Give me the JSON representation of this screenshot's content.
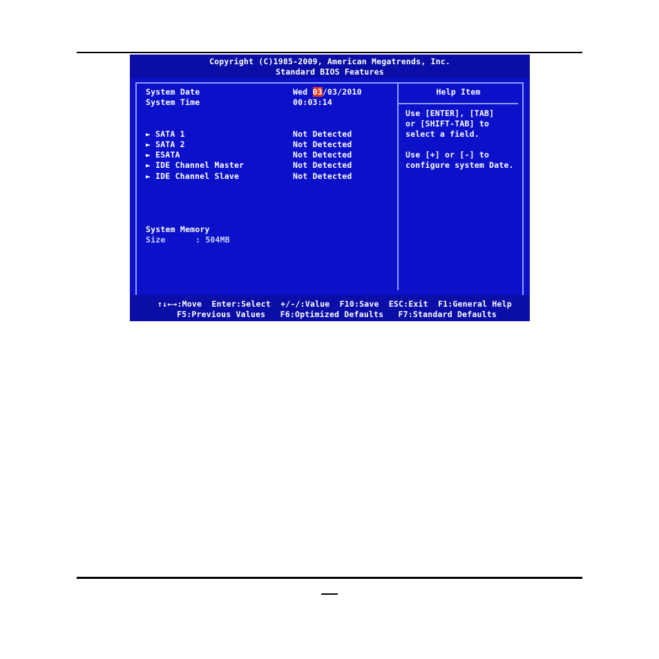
{
  "header": {
    "copyright": "Copyright (C)1985-2009, American Megatrends, Inc.",
    "screen_title": "Standard BIOS Features"
  },
  "settings": {
    "system_date": {
      "label": "System Date",
      "value_day": "Wed",
      "value_selected": "03",
      "value_rest": "/03/2010"
    },
    "system_time": {
      "label": "System Time",
      "value": "00:03:14"
    },
    "items": [
      {
        "label": "SATA 1",
        "value": "Not Detected"
      },
      {
        "label": "SATA 2",
        "value": "Not Detected"
      },
      {
        "label": "ESATA",
        "value": "Not Detected"
      },
      {
        "label": "IDE Channel Master",
        "value": "Not Detected"
      },
      {
        "label": "IDE Channel Slave",
        "value": "Not Detected"
      }
    ],
    "arrow_glyph": "►",
    "system_memory": {
      "label": "System Memory",
      "size_label": "Size",
      "size_value": ": 504MB"
    }
  },
  "help": {
    "title": "Help Item",
    "lines1": [
      "Use [ENTER], [TAB]",
      "or [SHIFT-TAB] to",
      "select a field."
    ],
    "lines2": [
      "Use [+] or [-] to",
      "configure system Date."
    ]
  },
  "footer": {
    "line1": "↑↓←→:Move  Enter:Select  +/-/:Value  F10:Save  ESC:Exit  F1:General Help",
    "line2": "F5:Previous Values   F6:Optimized Defaults   F7:Standard Defaults"
  },
  "colors": {
    "bios_background": "#0b10c9",
    "bios_header": "#0a0ea6",
    "border": "#8fa2ff",
    "selection": "#e23a1d"
  }
}
